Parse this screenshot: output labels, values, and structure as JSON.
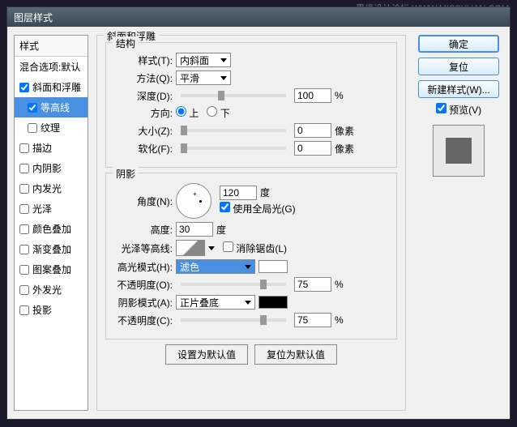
{
  "watermark": "思缘设计论坛 WWW.MISSYUAN.COM",
  "dialog_title": "图层样式",
  "left": {
    "header": "样式",
    "blend_options": "混合选项:默认",
    "items": [
      {
        "label": "斜面和浮雕",
        "checked": true,
        "selected": false
      },
      {
        "label": "等高线",
        "checked": true,
        "selected": true,
        "sub": true
      },
      {
        "label": "纹理",
        "checked": false,
        "selected": false,
        "sub": true
      },
      {
        "label": "描边",
        "checked": false
      },
      {
        "label": "内阴影",
        "checked": false
      },
      {
        "label": "内发光",
        "checked": false
      },
      {
        "label": "光泽",
        "checked": false
      },
      {
        "label": "颜色叠加",
        "checked": false
      },
      {
        "label": "渐变叠加",
        "checked": false
      },
      {
        "label": "图案叠加",
        "checked": false
      },
      {
        "label": "外发光",
        "checked": false
      },
      {
        "label": "投影",
        "checked": false
      }
    ]
  },
  "center": {
    "section_title": "斜面和浮雕",
    "structure_title": "结构",
    "style_label": "样式(T):",
    "style_value": "内斜面",
    "method_label": "方法(Q):",
    "method_value": "平滑",
    "depth_label": "深度(D):",
    "depth_value": "100",
    "depth_unit": "%",
    "direction_label": "方向:",
    "direction_up": "上",
    "direction_down": "下",
    "size_label": "大小(Z):",
    "size_value": "0",
    "size_unit": "像素",
    "soften_label": "软化(F):",
    "soften_value": "0",
    "soften_unit": "像素",
    "shading_title": "阴影",
    "angle_label": "角度(N):",
    "angle_value": "120",
    "angle_unit": "度",
    "global_light": "使用全局光(G)",
    "altitude_label": "高度:",
    "altitude_value": "30",
    "altitude_unit": "度",
    "gloss_label": "光泽等高线:",
    "antialias": "消除锯齿(L)",
    "highlight_mode_label": "高光模式(H):",
    "highlight_mode_value": "滤色",
    "highlight_color": "#ffffff",
    "highlight_opacity_label": "不透明度(O):",
    "highlight_opacity_value": "75",
    "opacity_unit": "%",
    "shadow_mode_label": "阴影模式(A):",
    "shadow_mode_value": "正片叠底",
    "shadow_color": "#000000",
    "shadow_opacity_label": "不透明度(C):",
    "shadow_opacity_value": "75",
    "default_btn": "设置为默认值",
    "reset_btn": "复位为默认值"
  },
  "right": {
    "ok": "确定",
    "cancel": "复位",
    "new_style": "新建样式(W)...",
    "preview": "预览(V)"
  }
}
